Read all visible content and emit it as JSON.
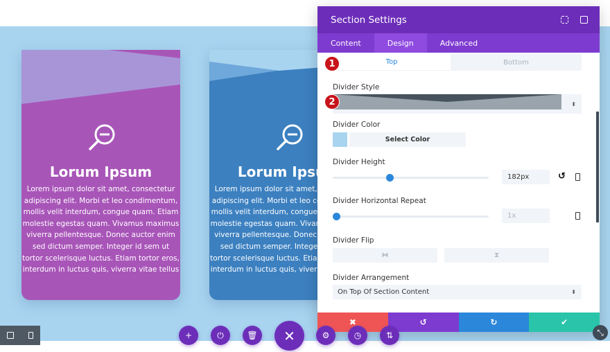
{
  "cards": [
    {
      "title": "Lorum Ipsum",
      "color": "#a855b8",
      "divider_color": "#a895d8",
      "lines": [
        "Lorem ipsum dolor sit amet, consectetur",
        "adipiscing elit. Morbi et leo condimentum,",
        "mollis velit interdum, congue quam. Etiam",
        "molestie egestas quam. Vivamus maximus",
        "viverra pellentesque. Donec auctor enim",
        "sed dictum semper. Integer id sem ut",
        "tortor scelerisque luctus. Etiam tortor eros,",
        "interdum in luctus quis, viverra vitae tellus"
      ]
    },
    {
      "title": "Lorum Ipsum",
      "color": "#3c80c0",
      "divider_color": "#6fa8da",
      "lines": [
        "Lorem ipsum dolor sit amet, consectetur",
        "adipiscing elit. Morbi et leo condimentum,",
        "mollis velit interdum, congue quam. Etiam",
        "molestie egestas quam. Vivamus maximus",
        "viverra pellentesque. Donec auctor enim",
        "sed dictum semper. Integer id sem ut",
        "tortor scelerisque luctus. Etiam tortor eros,",
        "interdum in luctus quis, viverra vitae tellus"
      ]
    }
  ],
  "modal": {
    "title": "Section Settings",
    "tabs": [
      "Content",
      "Design",
      "Advanced"
    ],
    "active_tab": "Design",
    "subtabs": [
      "Top",
      "Bottom"
    ],
    "active_subtab": "Top",
    "badges": [
      "1",
      "2"
    ],
    "divider_style_label": "Divider Style",
    "divider_color_label": "Divider Color",
    "divider_color_value": "#a8d4f0",
    "select_color": "Select Color",
    "divider_height_label": "Divider Height",
    "divider_height_value": "182px",
    "divider_height_fraction": 0.36,
    "divider_repeat_label": "Divider Horizontal Repeat",
    "divider_repeat_value": "1x",
    "divider_repeat_fraction": 0,
    "divider_flip_label": "Divider Flip",
    "divider_arrangement_label": "Divider Arrangement",
    "divider_arrangement_value": "On Top Of Section Content",
    "actions": {
      "cancel": "✖",
      "undo": "↺",
      "redo": "↻",
      "save": "✔"
    },
    "action_colors": [
      "#ef5555",
      "#7e3bd0",
      "#2b87da",
      "#29c4a9"
    ]
  },
  "accent": "#6c2eb9"
}
